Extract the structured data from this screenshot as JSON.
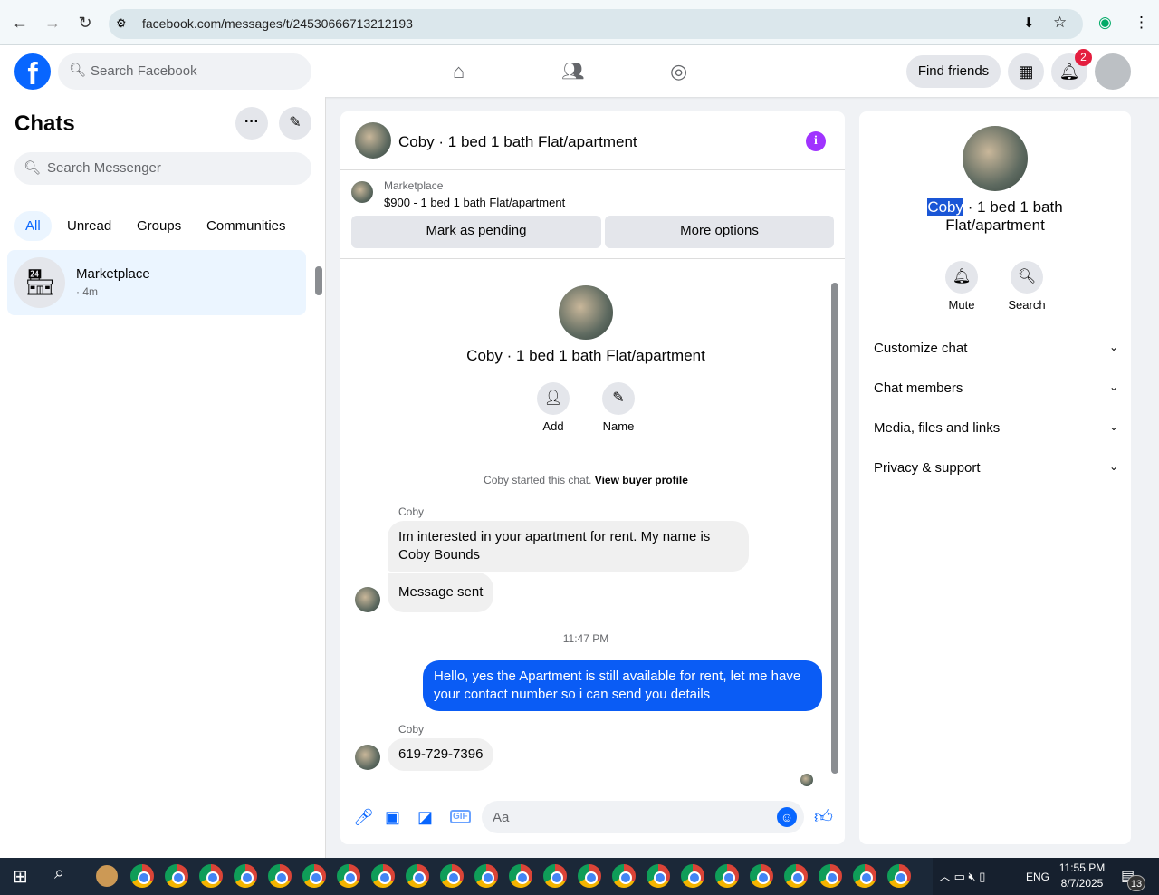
{
  "browser": {
    "url": "facebook.com/messages/t/24530666713212193"
  },
  "header": {
    "search_placeholder": "Search Facebook",
    "find_friends": "Find friends",
    "notification_count": "2"
  },
  "sidebar": {
    "title": "Chats",
    "search_placeholder": "Search Messenger",
    "filters": [
      "All",
      "Unread",
      "Groups",
      "Communities"
    ],
    "chats": [
      {
        "name": "Marketplace",
        "time": "· 4m"
      }
    ]
  },
  "chat": {
    "title": "Coby · 1 bed 1 bath Flat/apartment",
    "listing_label": "Marketplace",
    "listing": "$900 - 1 bed 1 bath Flat/apartment",
    "mark_pending": "Mark as pending",
    "more_options": "More options",
    "intro_name": "Coby · 1 bed 1 bath Flat/apartment",
    "add": "Add",
    "name": "Name",
    "started": "Coby started this chat.",
    "view_buyer": "View buyer profile",
    "messages": [
      {
        "sender": "Coby",
        "text": "Im interested in your apartment for rent. My name is Coby Bounds"
      },
      {
        "text": "Message sent"
      },
      {
        "timestamp": "11:47 PM"
      },
      {
        "text": "Hello, yes the Apartment is still available for rent, let me have your contact number so i can send you details"
      },
      {
        "sender": "Coby",
        "text": "619-729-7396"
      }
    ],
    "composer_placeholder": "Aa"
  },
  "info": {
    "name_highlight": "Coby",
    "name_rest": " · 1 bed 1 bath",
    "name_line2": "Flat/apartment",
    "mute": "Mute",
    "search": "Search",
    "sections": [
      "Customize chat",
      "Chat members",
      "Media, files and links",
      "Privacy & support"
    ]
  },
  "taskbar": {
    "lang": "ENG",
    "time": "11:55 PM",
    "date": "8/7/2025",
    "notif": "13",
    "chrome_count": 23
  },
  "colors": {
    "brand": "#0866ff",
    "outgoing": "#0a5cf5",
    "accent_purple": "#a033ff"
  }
}
